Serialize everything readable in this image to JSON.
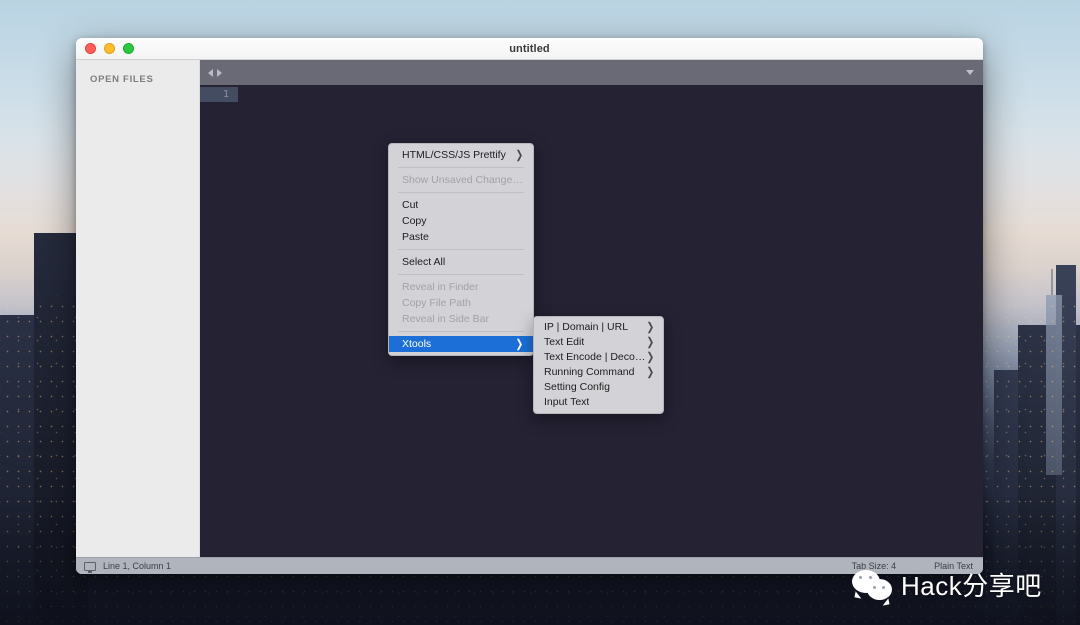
{
  "window": {
    "title": "untitled",
    "traffic_lights": [
      {
        "name": "close",
        "color": "#ff5f57"
      },
      {
        "name": "minimize",
        "color": "#ffbd2e"
      },
      {
        "name": "zoom",
        "color": "#28c840"
      }
    ]
  },
  "sidebar": {
    "header": "OPEN FILES",
    "items": []
  },
  "tabstrip": {
    "nav_prev_icon": "chevron-left-icon",
    "nav_next_icon": "chevron-right-icon",
    "menu_icon": "chevron-down-icon"
  },
  "editor": {
    "line_numbers": [
      "1"
    ],
    "content": "",
    "background": "#242233"
  },
  "statusbar": {
    "cursor_icon": "monitor-icon",
    "cursor_position": "Line 1, Column 1",
    "tab_size": "Tab Size: 4",
    "syntax_mode": "Plain Text"
  },
  "context_menu": {
    "highlight_color": "#1c6fd6",
    "background": "#d3d3d7",
    "items": [
      {
        "label": "HTML/CSS/JS Prettify",
        "submenu": true,
        "disabled": false,
        "selected": false
      },
      {
        "type": "separator"
      },
      {
        "label": "Show Unsaved Changes...",
        "submenu": false,
        "disabled": true,
        "selected": false
      },
      {
        "type": "separator"
      },
      {
        "label": "Cut",
        "submenu": false,
        "disabled": false,
        "selected": false
      },
      {
        "label": "Copy",
        "submenu": false,
        "disabled": false,
        "selected": false
      },
      {
        "label": "Paste",
        "submenu": false,
        "disabled": false,
        "selected": false
      },
      {
        "type": "separator"
      },
      {
        "label": "Select All",
        "submenu": false,
        "disabled": false,
        "selected": false
      },
      {
        "type": "separator"
      },
      {
        "label": "Reveal in Finder",
        "submenu": false,
        "disabled": true,
        "selected": false
      },
      {
        "label": "Copy File Path",
        "submenu": false,
        "disabled": true,
        "selected": false
      },
      {
        "label": "Reveal in Side Bar",
        "submenu": false,
        "disabled": true,
        "selected": false
      },
      {
        "type": "separator"
      },
      {
        "label": "Xtools",
        "submenu": true,
        "disabled": false,
        "selected": true
      }
    ]
  },
  "context_submenu": {
    "items": [
      {
        "label": "IP | Domain | URL",
        "submenu": true
      },
      {
        "label": "Text Edit",
        "submenu": true
      },
      {
        "label": "Text Encode | Decode",
        "submenu": true
      },
      {
        "label": "Running Command",
        "submenu": true
      },
      {
        "label": "Setting Config",
        "submenu": false
      },
      {
        "label": "Input Text",
        "submenu": false
      }
    ]
  },
  "watermark": {
    "logo": "wechat-logo",
    "text": "Hack分享吧"
  },
  "chevron_glyph": "❯"
}
